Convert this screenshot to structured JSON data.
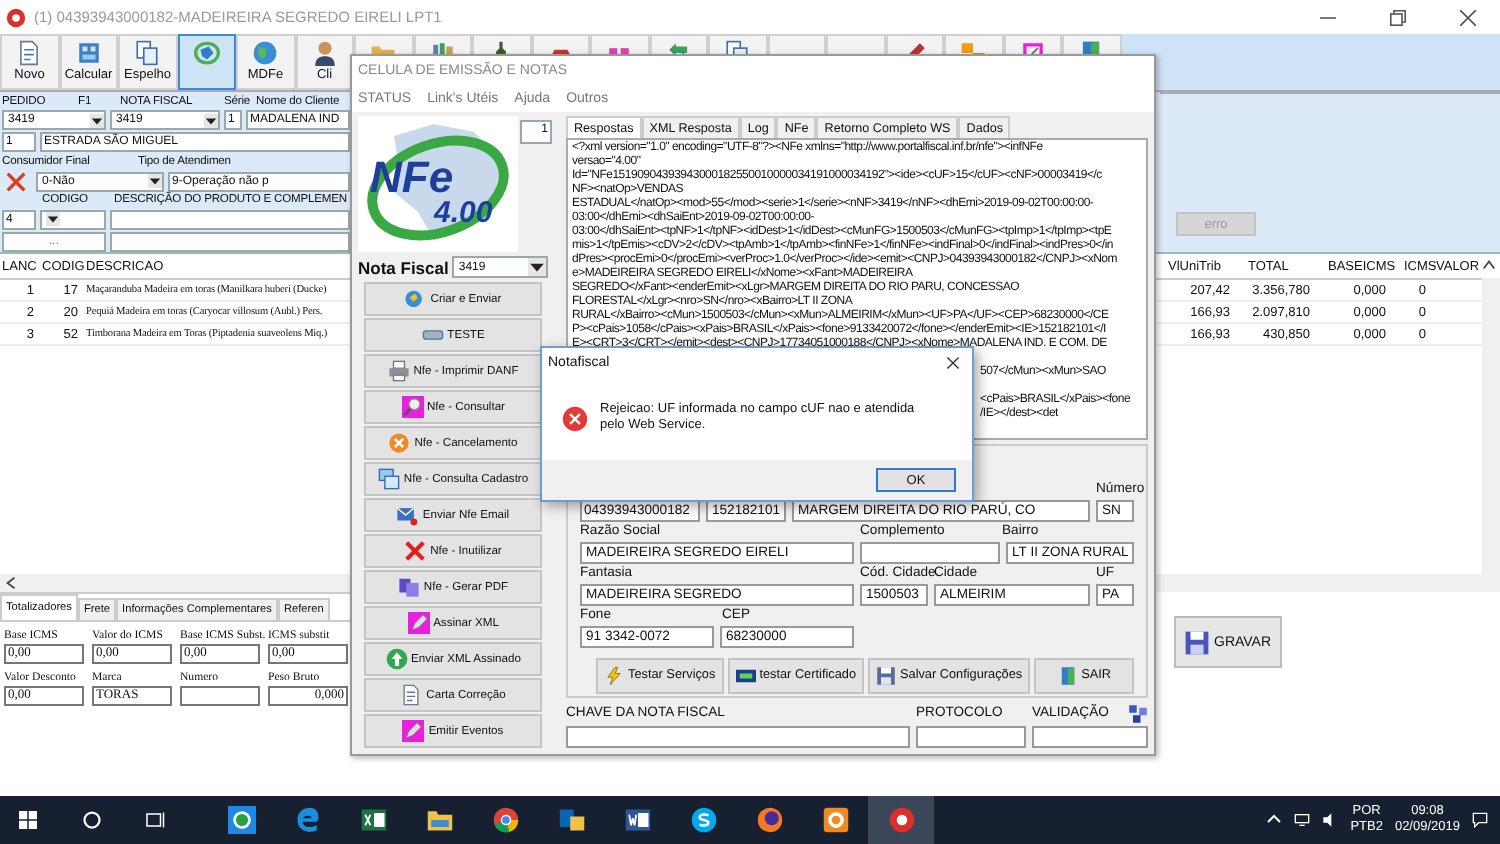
{
  "main_window": {
    "title": "(1) 04393943000182-MADEIREIRA SEGREDO EIRELI  LPT1",
    "toolbar": [
      {
        "kind": "document",
        "label": "Novo",
        "selected": false
      },
      {
        "kind": "calculator",
        "label": "Calcular",
        "selected": false
      },
      {
        "kind": "pages",
        "label": "Espelho",
        "selected": false
      },
      {
        "kind": "globe",
        "selected": true
      },
      {
        "kind": "earth",
        "label": "MDFe",
        "selected": false
      },
      {
        "kind": "person",
        "label": "Cli",
        "selected": false
      },
      {
        "kind": "folder",
        "selected": false
      },
      {
        "kind": "books",
        "selected": false
      },
      {
        "kind": "bottle",
        "selected": false
      },
      {
        "kind": "car",
        "selected": false
      },
      {
        "kind": "gift",
        "selected": false
      },
      {
        "kind": "arrows",
        "selected": false
      },
      {
        "kind": "pages",
        "selected": false
      },
      {
        "kind": "plain",
        "selected": false
      },
      {
        "kind": "plain",
        "selected": false
      },
      {
        "kind": "pencil",
        "selected": false
      },
      {
        "kind": "boxes",
        "selected": false
      },
      {
        "kind": "frame",
        "selected": false
      },
      {
        "kind": "door",
        "selected": false
      }
    ],
    "form": {
      "pedido_label": "PEDIDO",
      "f1_label": "F1",
      "pedido": "3419",
      "nota_label": "NOTA FISCAL",
      "serie_label": "Série",
      "cliente_label": "Nome do Cliente",
      "nota": "3419",
      "serie": "1",
      "cliente": "MADALENA IND",
      "sequence": "1",
      "endereco": "ESTRADA SÃO MIGUEL",
      "consumidor_label": "Consumidor Final",
      "atendimento_label": "Tipo de Atendimen",
      "consumidor": "0-Não",
      "atendimento": "9-Operação não p",
      "codigo_label": "CODIGO",
      "descricao_label": "DESCRIÇÃO DO PRODUTO E COMPLEMEN",
      "item": "4",
      "more": "...",
      "error_button": "erro"
    },
    "items": {
      "columns": [
        "LANC",
        "CODIG",
        "DESCRICAO",
        "VlUniTrib",
        "TOTAL",
        "BASEICMS",
        "ICMS",
        "VALOR"
      ],
      "rows": [
        {
          "lanc": "1",
          "codig": "17",
          "descricao": "Maçaranduba Madeira em toras (Manilkara huberi (Ducke)",
          "vluni": "207,42",
          "total": "3.356,780",
          "baseicms": "0,000",
          "icms": "0"
        },
        {
          "lanc": "2",
          "codig": "20",
          "descricao": "Pequiá Madeira em toras (Caryocar villosum (Aubl.) Pers.",
          "vluni": "166,93",
          "total": "2.097,810",
          "baseicms": "0,000",
          "icms": "0"
        },
        {
          "lanc": "3",
          "codig": "52",
          "descricao": "Timborana Madeira em Toras (Piptadenia suaveolens Miq.)",
          "vluni": "166,93",
          "total": "430,850",
          "baseicms": "0,000",
          "icms": "0"
        }
      ]
    },
    "bottom_tabs": [
      {
        "label": "Totalizadores",
        "selected": true
      },
      {
        "label": "Frete",
        "selected": false
      },
      {
        "label": "Informações Complementares",
        "selected": false
      },
      {
        "label": "Referen",
        "selected": false
      }
    ],
    "totals": [
      {
        "label": "Base ICMS",
        "value": "0,00"
      },
      {
        "label": "Valor do ICMS",
        "value": "0,00"
      },
      {
        "label": "Base ICMS Subst.",
        "value": "0,00"
      },
      {
        "label": "ICMS substit",
        "value": "0,00"
      },
      {
        "label": "Valor Desconto",
        "value": "0,00"
      },
      {
        "label": "Marca",
        "value": "TORAS"
      },
      {
        "label": "Numero"
      },
      {
        "label": "Peso Bruto",
        "value": "0,000",
        "kind": "number"
      }
    ],
    "save_button": "GRAVAR"
  },
  "nfe_window": {
    "title": "CELULA DE EMISSÃO E NOTAS",
    "menu": [
      "STATUS",
      "Link's Utéis",
      "Ajuda",
      "Outros"
    ],
    "logo": {
      "name": "NFe",
      "version": "4.00"
    },
    "counter": "1",
    "nota_label": "Nota Fiscal",
    "nota": "3419",
    "actions": [
      {
        "kind": "send",
        "label": "Criar e Enviar"
      },
      {
        "kind": "bar",
        "label": "TESTE"
      },
      {
        "kind": "printer",
        "label": "Nfe - Imprimir DANF"
      },
      {
        "kind": "magnifier",
        "label": "Nfe - Consultar"
      },
      {
        "kind": "cancel",
        "label": "Nfe - Cancelamento"
      },
      {
        "kind": "windows",
        "label": "Nfe - Consulta Cadastro"
      },
      {
        "kind": "envelope",
        "label": "Enviar Nfe Email"
      },
      {
        "kind": "cross",
        "label": "Nfe - Inutilizar"
      },
      {
        "kind": "documents",
        "label": "Nfe - Gerar PDF"
      },
      {
        "kind": "pen",
        "label": "Assinar XML"
      },
      {
        "kind": "up",
        "label": "Enviar XML Assinado"
      },
      {
        "kind": "letter",
        "label": "Carta Correção"
      },
      {
        "kind": "pen",
        "label": "Emitir Eventos"
      }
    ],
    "tabs": [
      {
        "label": "Respostas",
        "selected": true
      },
      {
        "label": "XML Resposta",
        "selected": false
      },
      {
        "label": "Log",
        "selected": false
      },
      {
        "label": "NFe",
        "selected": false
      },
      {
        "label": "Retorno Completo WS",
        "selected": false
      },
      {
        "label": "Dados",
        "selected": false
      }
    ],
    "xml_lines": [
      {
        "kind": "full",
        "text": "<?xml version=\"1.0\" encoding=\"UTF-8\"?><NFe xmlns=\"http://www.portalfiscal.inf.br/nfe\"><infNFe"
      },
      {
        "kind": "full",
        "text": "versao=\"4.00\""
      },
      {
        "kind": "full",
        "text": "Id=\"NFe15190904393943000182550010000034191000034192\"><ide><cUF>15</cUF><cNF>00003419</c"
      },
      {
        "kind": "full",
        "text": "NF><natOp>VENDAS"
      },
      {
        "kind": "full",
        "text": "ESTADUAL</natOp><mod>55</mod><serie>1</serie><nNF>3419</nNF><dhEmi>2019-09-02T00:00:00-"
      },
      {
        "kind": "full",
        "text": "03:00</dhEmi><dhSaiEnt>2019-09-02T00:00:00-"
      },
      {
        "kind": "full",
        "text": "03:00</dhSaiEnt><tpNF>1</tpNF><idDest>1</idDest><cMunFG>1500503</cMunFG><tpImp>1</tpImp><tpE"
      },
      {
        "kind": "full",
        "text": "mis>1</tpEmis><cDV>2</cDV><tpAmb>1</tpAmb><finNFe>1</finNFe><indFinal>0</indFinal><indPres>0</in"
      },
      {
        "kind": "full",
        "text": "dPres><procEmi>0</procEmi><verProc>1.0</verProc></ide><emit><CNPJ>04393943000182</CNPJ><xNom"
      },
      {
        "kind": "full",
        "text": "e>MADEIREIRA SEGREDO EIRELI</xNome><xFant>MADEIREIRA"
      },
      {
        "kind": "full",
        "text": "SEGREDO</xFant><enderEmit><xLgr>MARGEM DIREITA DO RIO PARU, CONCESSAO"
      },
      {
        "kind": "full",
        "text": "FLORESTAL</xLgr><nro>SN</nro><xBairro>LT II ZONA"
      },
      {
        "kind": "full",
        "text": "RURAL</xBairro><cMun>1500503</cMun><xMun>ALMEIRIM</xMun><UF>PA</UF><CEP>68230000</CE"
      },
      {
        "kind": "full",
        "text": "P><cPais>1058</cPais><xPais>BRASIL</xPais><fone>9133420072</fone></enderEmit><IE>152182101</I"
      },
      {
        "kind": "full",
        "text": "E><CRT>3</CRT></emit><dest><CNPJ>17734051000188</CNPJ><xNome>MADALENA IND. E COM. DE"
      },
      {
        "kind": "gap"
      },
      {
        "kind": "tail",
        "text": "507</cMun><xMun>SAO"
      },
      {
        "kind": "gap"
      },
      {
        "kind": "tail",
        "text": "<cPais>BRASIL</xPais><fone"
      },
      {
        "kind": "tail",
        "text": "/IE></dest><det"
      }
    ],
    "emitente": {
      "cnpj": "04393943000182",
      "ie": "152182101",
      "numero_label": "Número",
      "logradouro": "MARGEM DIREITA DO RIO PARÚ, CO",
      "numero": "SN",
      "razao_label": "Razão Social",
      "razao": "MADEIREIRA SEGREDO EIRELI",
      "complemento_label": "Complemento",
      "bairro_label": "Bairro",
      "bairro": "LT II ZONA RURAL",
      "fantasia_label": "Fantasia",
      "fantasia": "MADEIREIRA SEGREDO",
      "cod_cidade_label": "Cód. Cidade",
      "cod_cidade": "1500503",
      "cidade_label": "Cidade",
      "cidade": "ALMEIRIM",
      "uf_label": "UF",
      "uf": "PA",
      "fone_label": "Fone",
      "fone": "91 3342-0072",
      "cep_label": "CEP",
      "cep": "68230000"
    },
    "buttons": [
      {
        "kind": "lightning",
        "label": "Testar Serviços"
      },
      {
        "kind": "certificate",
        "label": "testar Certificado"
      },
      {
        "kind": "save",
        "label": "Salvar Configurações"
      },
      {
        "kind": "door",
        "label": "SAIR"
      }
    ],
    "footer": {
      "chave_label": "CHAVE DA NOTA FISCAL",
      "protocolo_label": "PROTOCOLO",
      "validacao_label": "VALIDAÇÃO"
    }
  },
  "dialog": {
    "title": "Notafiscal",
    "message": "Rejeicao: UF informada no campo cUF nao e atendida pelo Web Service.",
    "ok": "OK"
  },
  "taskbar": {
    "apps": [
      {
        "kind": "whatsapp",
        "selected": false
      },
      {
        "kind": "edge",
        "selected": false
      },
      {
        "kind": "excel",
        "selected": false
      },
      {
        "kind": "explorer",
        "selected": false
      },
      {
        "kind": "chrome",
        "selected": false
      },
      {
        "kind": "outlook",
        "selected": false
      },
      {
        "kind": "word",
        "selected": false
      },
      {
        "kind": "skype",
        "selected": false
      },
      {
        "kind": "firefox",
        "selected": false
      },
      {
        "kind": "orange",
        "selected": false
      },
      {
        "kind": "red",
        "selected": true
      }
    ],
    "language": "POR",
    "layout": "PTB2",
    "time": "09:08",
    "date": "02/09/2019"
  }
}
